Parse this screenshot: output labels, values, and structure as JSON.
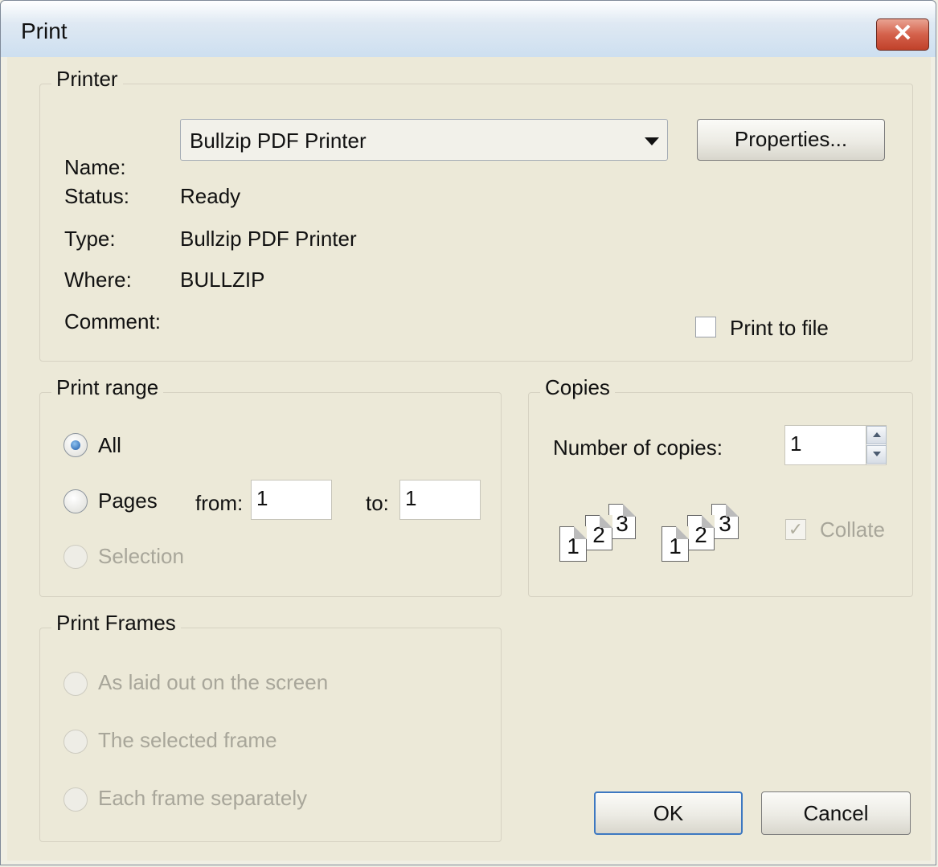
{
  "window": {
    "title": "Print",
    "close_label": "✕"
  },
  "printer": {
    "group_label": "Printer",
    "name_label": "Name:",
    "name_value": "Bullzip PDF Printer",
    "properties_label": "Properties...",
    "status_label": "Status:",
    "status_value": "Ready",
    "type_label": "Type:",
    "type_value": "Bullzip PDF Printer",
    "where_label": "Where:",
    "where_value": "BULLZIP",
    "comment_label": "Comment:",
    "print_to_file_label": "Print to file"
  },
  "print_range": {
    "group_label": "Print range",
    "all_label": "All",
    "pages_label": "Pages",
    "from_label": "from:",
    "from_value": "1",
    "to_label": "to:",
    "to_value": "1",
    "selection_label": "Selection"
  },
  "copies": {
    "group_label": "Copies",
    "number_label": "Number of copies:",
    "number_value": "1",
    "collate_label": "Collate",
    "collate_check": "✓",
    "page_numbers": [
      "1",
      "2",
      "3"
    ]
  },
  "print_frames": {
    "group_label": "Print Frames",
    "options": [
      "As laid out on the screen",
      "The selected frame",
      "Each frame separately"
    ]
  },
  "buttons": {
    "ok_label": "OK",
    "cancel_label": "Cancel"
  }
}
